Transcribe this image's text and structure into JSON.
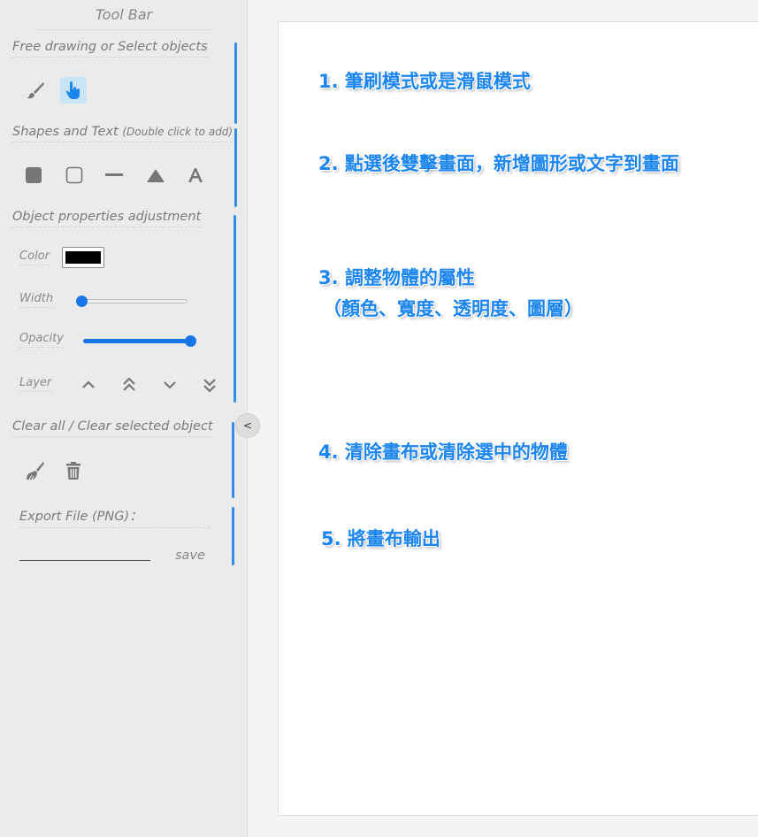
{
  "toolbar": {
    "title": "Tool Bar",
    "sections": {
      "draw_select": {
        "title": "Free drawing or Select objects"
      },
      "shapes_text": {
        "title": "Shapes and Text",
        "hint": "(Double click to add)"
      },
      "properties": {
        "title": "Object properties adjustment",
        "color_label": "Color",
        "color_value": "#000000",
        "width_label": "Width",
        "width_value": 0,
        "opacity_label": "Opacity",
        "opacity_value": 1,
        "layer_label": "Layer"
      },
      "clear": {
        "title": "Clear all / Clear selected object"
      },
      "export": {
        "title": "Export File (PNG)：",
        "filename_value": "",
        "save_label": "save"
      }
    },
    "icons": {
      "draw_select": [
        "brush-icon",
        "pointer-hand-icon"
      ],
      "shapes": [
        "filled-square-icon",
        "outline-square-icon",
        "line-icon",
        "triangle-icon",
        "text-icon"
      ],
      "layer": [
        "chevron-up-icon",
        "double-chevron-up-icon",
        "chevron-down-icon",
        "double-chevron-down-icon"
      ],
      "clear": [
        "sweep-brush-icon",
        "trash-icon"
      ]
    },
    "collapse_label": "<",
    "accent_color": "#2f8ee6"
  },
  "canvas": {
    "notes": [
      "1. 筆刷模式或是滑鼠模式",
      "2. 點選後雙擊畫面，新增圖形或文字到畫面",
      "3. 調整物體的屬性",
      "（顏色、寬度、透明度、圖層）",
      "4. 清除畫布或清除選中的物體",
      "5. 將畫布輸出"
    ],
    "note_color": "#1d86ec"
  }
}
